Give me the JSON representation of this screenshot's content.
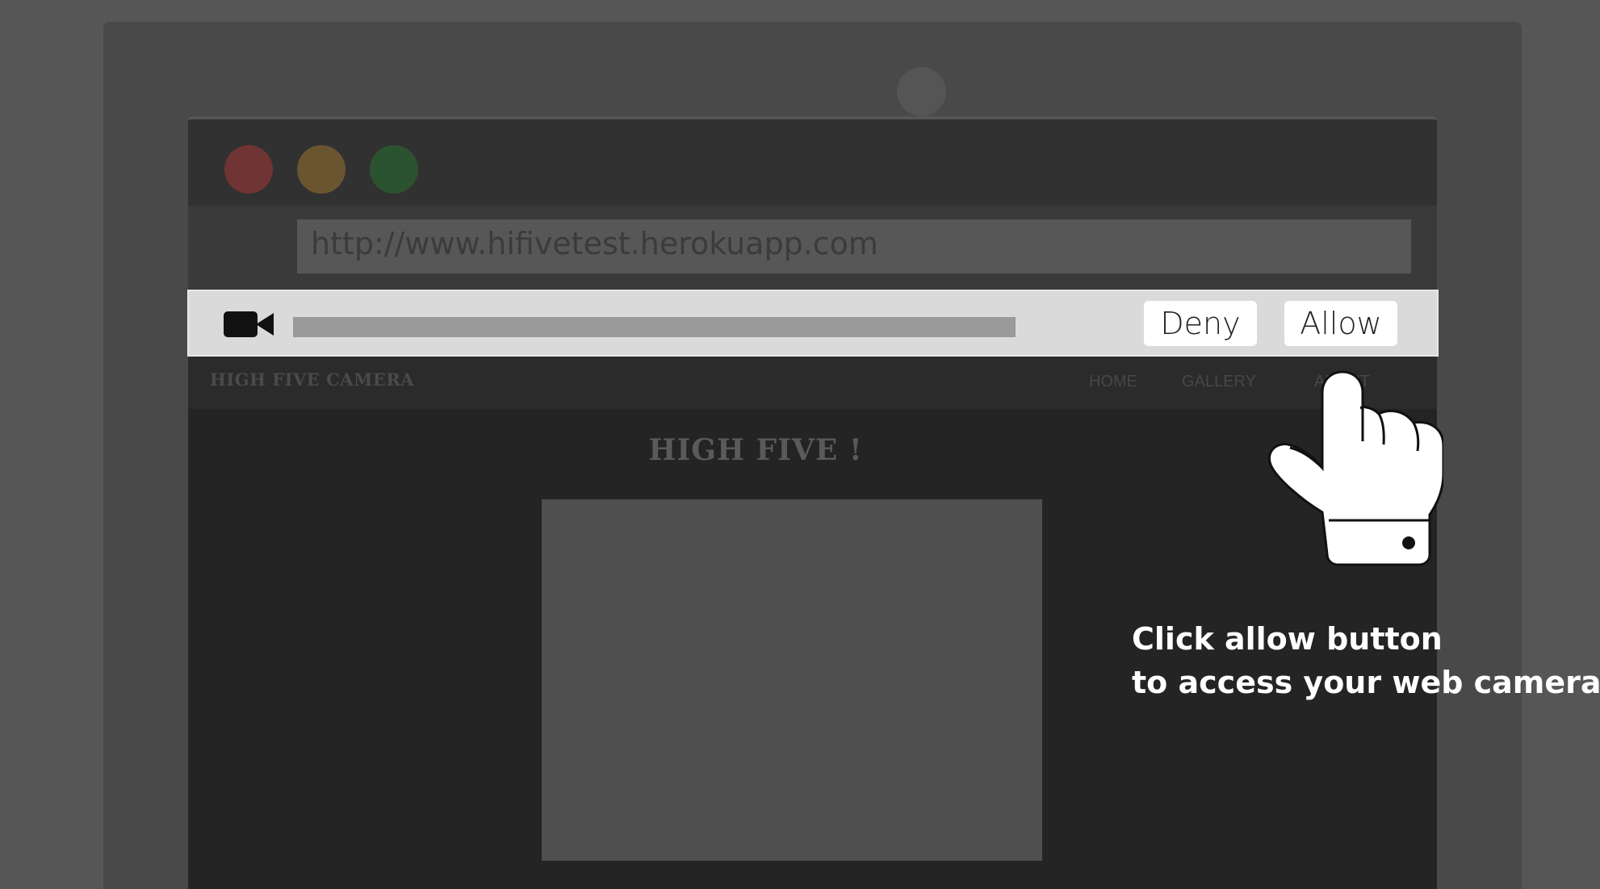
{
  "browser": {
    "url": "http://www.hifivetest.herokuapp.com"
  },
  "permission_prompt": {
    "icon": "video-camera-icon",
    "deny_label": "Deny",
    "allow_label": "Allow"
  },
  "site": {
    "brand": "HIGH FIVE CAMERA",
    "nav": [
      "HOME",
      "GALLERY",
      "ABOUT"
    ],
    "heading": "HIGH FIVE !"
  },
  "overlay": {
    "pointer_icon": "pointing-hand-icon",
    "hint_line1": "Click allow button",
    "hint_line2": "to access your web camera"
  },
  "colors": {
    "traffic_red": "#6f3433",
    "traffic_yellow": "#6b5530",
    "traffic_green": "#2c5330",
    "permission_bar": "#dadada"
  }
}
